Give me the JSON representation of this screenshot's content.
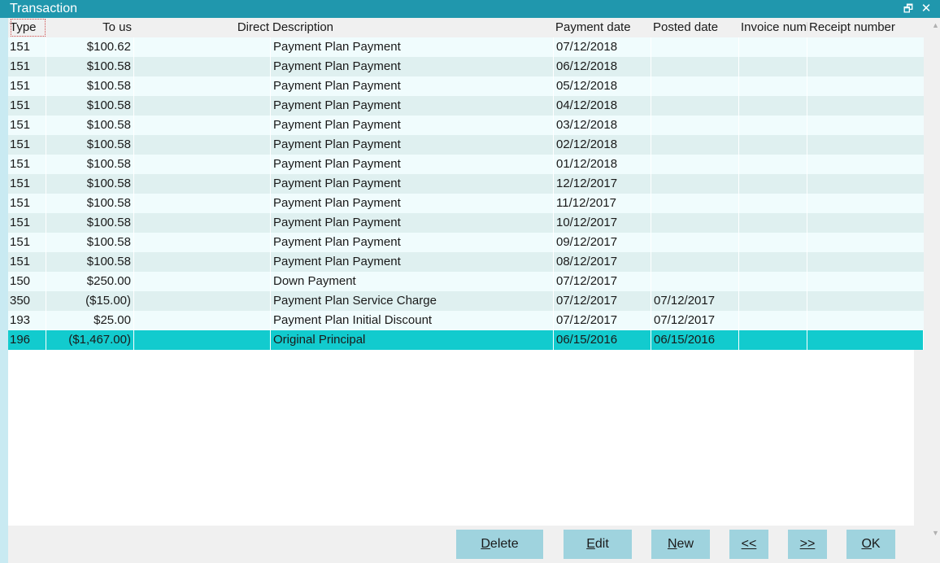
{
  "window": {
    "title": "Transaction",
    "restore_icon": "restore-icon",
    "close_icon": "close-icon"
  },
  "columns": {
    "type": "Type",
    "to_us": "To us",
    "direct": "Direct",
    "description": "Description",
    "payment_date": "Payment date",
    "posted_date": "Posted date",
    "invoice_number": "Invoice number",
    "receipt_number": "Receipt number"
  },
  "rows": [
    {
      "type": "151",
      "to_us": "$100.62",
      "direct": "",
      "description": "Payment Plan Payment",
      "payment_date": "07/12/2018",
      "posted_date": "",
      "invoice_number": "",
      "receipt_number": ""
    },
    {
      "type": "151",
      "to_us": "$100.58",
      "direct": "",
      "description": "Payment Plan Payment",
      "payment_date": "06/12/2018",
      "posted_date": "",
      "invoice_number": "",
      "receipt_number": ""
    },
    {
      "type": "151",
      "to_us": "$100.58",
      "direct": "",
      "description": "Payment Plan Payment",
      "payment_date": "05/12/2018",
      "posted_date": "",
      "invoice_number": "",
      "receipt_number": ""
    },
    {
      "type": "151",
      "to_us": "$100.58",
      "direct": "",
      "description": "Payment Plan Payment",
      "payment_date": "04/12/2018",
      "posted_date": "",
      "invoice_number": "",
      "receipt_number": ""
    },
    {
      "type": "151",
      "to_us": "$100.58",
      "direct": "",
      "description": "Payment Plan Payment",
      "payment_date": "03/12/2018",
      "posted_date": "",
      "invoice_number": "",
      "receipt_number": ""
    },
    {
      "type": "151",
      "to_us": "$100.58",
      "direct": "",
      "description": "Payment Plan Payment",
      "payment_date": "02/12/2018",
      "posted_date": "",
      "invoice_number": "",
      "receipt_number": ""
    },
    {
      "type": "151",
      "to_us": "$100.58",
      "direct": "",
      "description": "Payment Plan Payment",
      "payment_date": "01/12/2018",
      "posted_date": "",
      "invoice_number": "",
      "receipt_number": ""
    },
    {
      "type": "151",
      "to_us": "$100.58",
      "direct": "",
      "description": "Payment Plan Payment",
      "payment_date": "12/12/2017",
      "posted_date": "",
      "invoice_number": "",
      "receipt_number": ""
    },
    {
      "type": "151",
      "to_us": "$100.58",
      "direct": "",
      "description": "Payment Plan Payment",
      "payment_date": "11/12/2017",
      "posted_date": "",
      "invoice_number": "",
      "receipt_number": ""
    },
    {
      "type": "151",
      "to_us": "$100.58",
      "direct": "",
      "description": "Payment Plan Payment",
      "payment_date": "10/12/2017",
      "posted_date": "",
      "invoice_number": "",
      "receipt_number": ""
    },
    {
      "type": "151",
      "to_us": "$100.58",
      "direct": "",
      "description": "Payment Plan Payment",
      "payment_date": "09/12/2017",
      "posted_date": "",
      "invoice_number": "",
      "receipt_number": ""
    },
    {
      "type": "151",
      "to_us": "$100.58",
      "direct": "",
      "description": "Payment Plan Payment",
      "payment_date": "08/12/2017",
      "posted_date": "",
      "invoice_number": "",
      "receipt_number": ""
    },
    {
      "type": "150",
      "to_us": "$250.00",
      "direct": "",
      "description": "Down Payment",
      "payment_date": "07/12/2017",
      "posted_date": "",
      "invoice_number": "",
      "receipt_number": ""
    },
    {
      "type": "350",
      "to_us": "($15.00)",
      "direct": "",
      "description": "Payment Plan Service Charge",
      "payment_date": "07/12/2017",
      "posted_date": "07/12/2017",
      "invoice_number": "",
      "receipt_number": ""
    },
    {
      "type": "193",
      "to_us": "$25.00",
      "direct": "",
      "description": "Payment Plan Initial Discount",
      "payment_date": "07/12/2017",
      "posted_date": "07/12/2017",
      "invoice_number": "",
      "receipt_number": ""
    },
    {
      "type": "196",
      "to_us": "($1,467.00)",
      "direct": "",
      "description": "Original Principal",
      "payment_date": "06/15/2016",
      "posted_date": "06/15/2016",
      "invoice_number": "",
      "receipt_number": "",
      "selected": true
    }
  ],
  "buttons": {
    "delete": {
      "mnemonic": "D",
      "rest": "elete"
    },
    "edit": {
      "mnemonic": "E",
      "rest": "dit"
    },
    "new": {
      "mnemonic": "N",
      "rest": "ew"
    },
    "prev": {
      "mnemonic": "<<",
      "rest": ""
    },
    "next": {
      "mnemonic": ">>",
      "rest": ""
    },
    "ok": {
      "mnemonic": "O",
      "rest": "K"
    }
  },
  "colors": {
    "titlebar": "#2097ad",
    "row_odd": "#f0fcfd",
    "row_even": "#dff0f0",
    "row_selected": "#12cbce",
    "button": "#9fd3de"
  }
}
